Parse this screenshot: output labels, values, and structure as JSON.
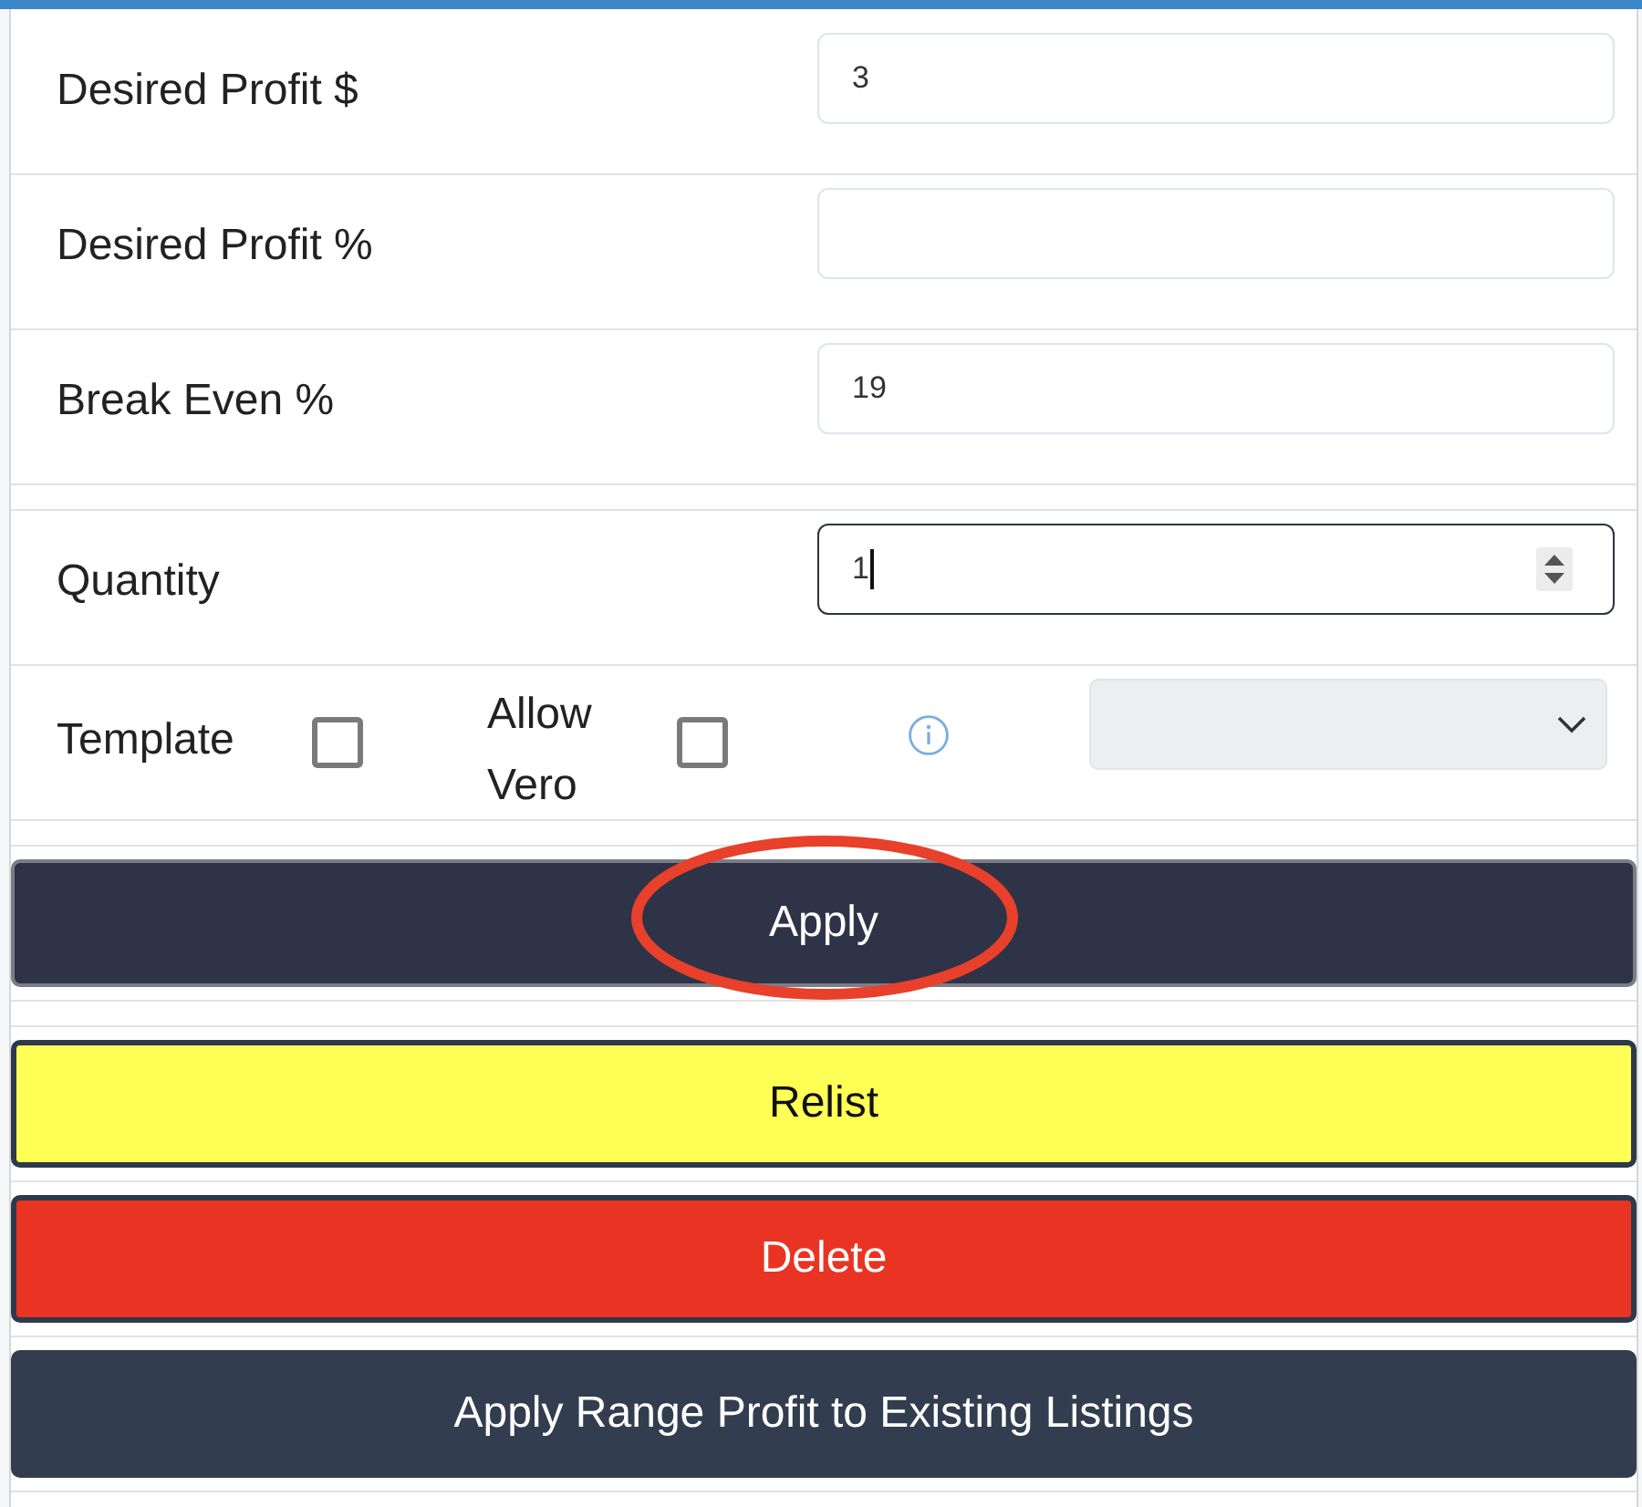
{
  "form_sections": [
    {
      "fields": [
        {
          "label": "Desired Profit $",
          "value": "3",
          "kind": "text",
          "focused": false
        },
        {
          "label": "Desired Profit %",
          "kind": "text",
          "focused": false
        },
        {
          "label": "Break Even %",
          "value": "19",
          "kind": "text",
          "focused": false
        }
      ]
    },
    {
      "fields": [
        {
          "label": "Quantity",
          "value": "1",
          "kind": "number",
          "focused": true
        }
      ],
      "options": {
        "checkboxes": [
          {
            "label": "Template",
            "checked": false
          },
          {
            "label": "Allow Vero",
            "checked": false
          }
        ],
        "dropdown": {
          "disabled": true
        }
      }
    }
  ],
  "button_groups": [
    {
      "buttons": [
        {
          "label": "Apply",
          "kind": "primary",
          "circled": true
        }
      ]
    },
    {
      "buttons": [
        {
          "label": "Relist",
          "kind": "warning",
          "circled": false
        },
        {
          "label": "Delete",
          "kind": "danger",
          "circled": false
        },
        {
          "label": "Apply Range Profit to Existing Listings",
          "kind": "dark",
          "circled": false
        }
      ]
    }
  ]
}
